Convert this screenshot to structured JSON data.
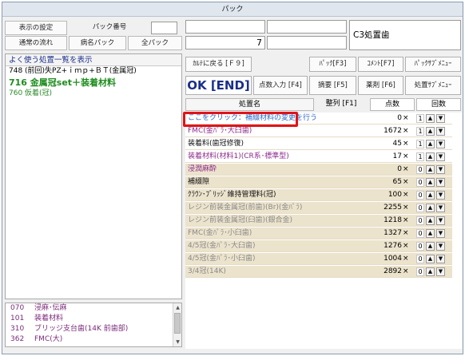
{
  "window": {
    "title": "パック"
  },
  "left_top": {
    "display_settings": "表示の設定",
    "pack_number_label": "パック番号",
    "normal_flow": "通常の流れ",
    "disease_pack": "病名パック",
    "all_pack": "全パック"
  },
  "quick_list": {
    "title": "よく使う処置一覧を表示",
    "items": [
      {
        "text": "748 (前回)失PZ+ｉｍｐ+ＢＴ(金属冠)"
      },
      {
        "text": "716 金属冠set＋装着材料"
      },
      {
        "text": "760 仮着(冠)"
      }
    ]
  },
  "bottom_list": {
    "items": [
      {
        "code": "070",
        "name": "浸麻･伝麻"
      },
      {
        "code": "101",
        "name": "装着材料"
      },
      {
        "code": "310",
        "name": "ブリッジ支台歯(14K 前歯部)"
      },
      {
        "code": "362",
        "name": "FMC(大)"
      }
    ]
  },
  "header": {
    "count_value": "7",
    "c3_label": "C3処置歯"
  },
  "buttons": {
    "back_chart": "ｶﾙﾃに戻る [Ｆ９]",
    "pack_f3": "ﾊﾟｯｸ[F3]",
    "comment_f7": "ｺﾒﾝﾄ[F7]",
    "pack_submenu": "ﾊﾟｯｸｻﾌﾞﾒﾆｭｰ",
    "ok_end": "OK [END]",
    "points_input": "点数入力 [F4]",
    "summary_f5": "摘要 [F5]",
    "medicine_f6": "薬剤 [F6]",
    "procedure_submenu": "処置ｻﾌﾞﾒﾆｭｰ"
  },
  "table": {
    "headers": {
      "name": "処置名",
      "order": "整列 [F1]",
      "points": "点数",
      "count": "回数"
    },
    "rows": [
      {
        "name": "ここをクリック：補綴材料の変更を行う",
        "points": "0",
        "count": "1",
        "style": "blue",
        "bg": "white"
      },
      {
        "name": "FMC(金ﾊﾟﾗ･大臼歯)",
        "points": "1672",
        "count": "1",
        "style": "purple",
        "bg": "white"
      },
      {
        "name": "装着料(歯冠修復)",
        "points": "45",
        "count": "1",
        "style": "black",
        "bg": "white"
      },
      {
        "name": "装着材料(材料1)(CR系･標準型)",
        "points": "17",
        "count": "1",
        "style": "purple",
        "bg": "white"
      },
      {
        "name": "浸潤麻酔",
        "points": "0",
        "count": "0",
        "style": "purple",
        "bg": "tan"
      },
      {
        "name": "補綴隙",
        "points": "65",
        "count": "0",
        "style": "black",
        "bg": "tan"
      },
      {
        "name": "ｸﾗｳﾝ･ﾌﾞﾘｯｼﾞ維持管理料(冠)",
        "points": "100",
        "count": "0",
        "style": "black",
        "bg": "tan"
      },
      {
        "name": "レジン前装金属冠(前歯)(Br)(金ﾊﾟﾗ)",
        "points": "2255",
        "count": "0",
        "style": "gray",
        "bg": "tan"
      },
      {
        "name": "レジン前装金属冠(臼歯)(銀合金)",
        "points": "1218",
        "count": "0",
        "style": "gray",
        "bg": "tan"
      },
      {
        "name": "FMC(金ﾊﾟﾗ･小臼歯)",
        "points": "1327",
        "count": "0",
        "style": "gray",
        "bg": "tan"
      },
      {
        "name": "4/5冠(金ﾊﾟﾗ･大臼歯)",
        "points": "1276",
        "count": "0",
        "style": "gray",
        "bg": "tan"
      },
      {
        "name": "4/5冠(金ﾊﾟﾗ･小臼歯)",
        "points": "1004",
        "count": "0",
        "style": "gray",
        "bg": "tan"
      },
      {
        "name": "3/4冠(14K)",
        "points": "2892",
        "count": "0",
        "style": "gray",
        "bg": "tan"
      }
    ]
  },
  "symbols": {
    "times": "×",
    "up": "▲",
    "down": "▼"
  }
}
